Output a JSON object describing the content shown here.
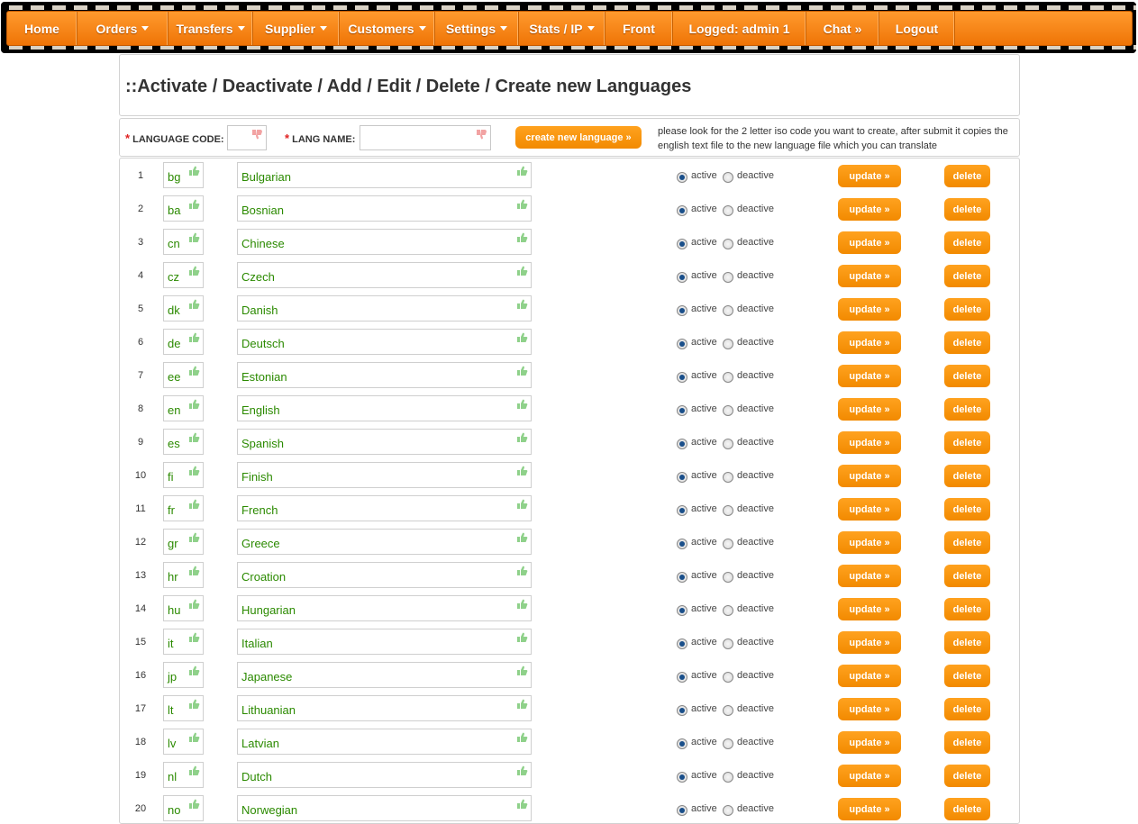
{
  "nav": {
    "items": [
      {
        "label": "Home",
        "dropdown": false
      },
      {
        "label": "Orders",
        "dropdown": true
      },
      {
        "label": "Transfers",
        "dropdown": true
      },
      {
        "label": "Supplier",
        "dropdown": true
      },
      {
        "label": "Customers",
        "dropdown": true
      },
      {
        "label": "Settings",
        "dropdown": true
      },
      {
        "label": "Stats / IP",
        "dropdown": true
      },
      {
        "label": "Front",
        "dropdown": false
      },
      {
        "label": "Logged: admin 1",
        "dropdown": false
      },
      {
        "label": "Chat »",
        "dropdown": false
      },
      {
        "label": "Logout",
        "dropdown": false
      }
    ]
  },
  "page": {
    "title": "::Activate / Deactivate / Add / Edit / Delete / Create new Languages"
  },
  "create_form": {
    "required_mark": "*",
    "code_label": "LANGUAGE CODE:",
    "code_value": "",
    "name_label": "LANG NAME:",
    "name_value": "",
    "submit_label": "create new language »",
    "note": "please look for the 2 letter iso code you want to create, after submit it copies the english text file to the new language file which you can translate"
  },
  "labels": {
    "active": "active",
    "deactive": "deactive",
    "update": "update »",
    "delete": "delete"
  },
  "colors": {
    "accent": "#f28a00",
    "value_text": "#2b8a00"
  },
  "languages": [
    {
      "num": "1",
      "code": "bg",
      "name": "Bulgarian",
      "status": "active"
    },
    {
      "num": "2",
      "code": "ba",
      "name": "Bosnian",
      "status": "active"
    },
    {
      "num": "3",
      "code": "cn",
      "name": "Chinese",
      "status": "active"
    },
    {
      "num": "4",
      "code": "cz",
      "name": "Czech",
      "status": "active"
    },
    {
      "num": "5",
      "code": "dk",
      "name": "Danish",
      "status": "active"
    },
    {
      "num": "6",
      "code": "de",
      "name": "Deutsch",
      "status": "active"
    },
    {
      "num": "7",
      "code": "ee",
      "name": "Estonian",
      "status": "active"
    },
    {
      "num": "8",
      "code": "en",
      "name": "English",
      "status": "active"
    },
    {
      "num": "9",
      "code": "es",
      "name": "Spanish",
      "status": "active"
    },
    {
      "num": "10",
      "code": "fi",
      "name": "Finish",
      "status": "active"
    },
    {
      "num": "11",
      "code": "fr",
      "name": "French",
      "status": "active"
    },
    {
      "num": "12",
      "code": "gr",
      "name": "Greece",
      "status": "active"
    },
    {
      "num": "13",
      "code": "hr",
      "name": "Croation",
      "status": "active"
    },
    {
      "num": "14",
      "code": "hu",
      "name": "Hungarian",
      "status": "active"
    },
    {
      "num": "15",
      "code": "it",
      "name": "Italian",
      "status": "active"
    },
    {
      "num": "16",
      "code": "jp",
      "name": "Japanese",
      "status": "active"
    },
    {
      "num": "17",
      "code": "lt",
      "name": "Lithuanian",
      "status": "active"
    },
    {
      "num": "18",
      "code": "lv",
      "name": "Latvian",
      "status": "active"
    },
    {
      "num": "19",
      "code": "nl",
      "name": "Dutch",
      "status": "active"
    },
    {
      "num": "20",
      "code": "no",
      "name": "Norwegian",
      "status": "active"
    }
  ]
}
